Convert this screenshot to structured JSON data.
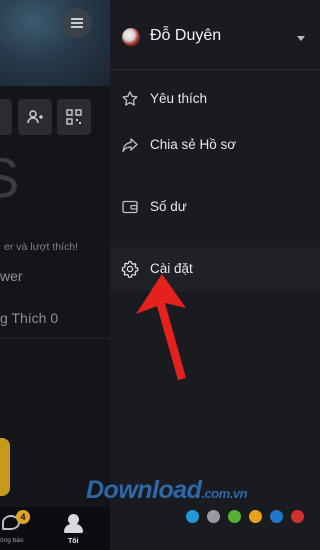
{
  "profile_panel": {
    "partial_text_1": "er và lượt thích!",
    "partial_text_2": "wer",
    "partial_text_3": "g Thích 0",
    "nav": {
      "notifications_label": "ông báo",
      "notifications_badge": "4",
      "me_label": "Tôi"
    }
  },
  "drawer": {
    "username": "Đỗ Duyên",
    "items": [
      {
        "label": "Yêu thích",
        "icon": "star-icon"
      },
      {
        "label": "Chia sẻ Hồ sơ",
        "icon": "share-icon"
      },
      {
        "label": "Số dư",
        "icon": "wallet-icon"
      },
      {
        "label": "Cài đặt",
        "icon": "gear-icon"
      }
    ],
    "active_item": "Cài đặt"
  },
  "watermark": {
    "brand": "Download",
    "domain": ".com.vn",
    "dot_colors": [
      "#1f9ad6",
      "#9a9a9a",
      "#56b036",
      "#e8a21d",
      "#1f78c8",
      "#d0312d"
    ]
  },
  "colors": {
    "drawer_bg": "#1a1b20",
    "arrow": "#e5211e"
  }
}
